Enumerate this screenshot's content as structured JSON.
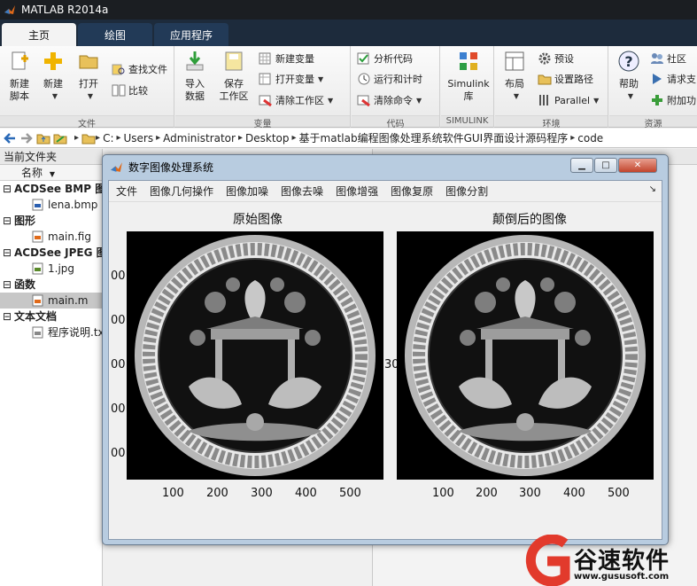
{
  "window": {
    "title": "MATLAB R2014a"
  },
  "ribbon_tabs": [
    {
      "label": "主页"
    },
    {
      "label": "绘图"
    },
    {
      "label": "应用程序"
    }
  ],
  "ribbon": {
    "new_script": "新建\n脚本",
    "new": "新建",
    "open": "打开",
    "find_files": "查找文件",
    "compare": "比较",
    "file_group": "文件",
    "import_data": "导入\n数据",
    "save_workspace": "保存\n工作区",
    "new_variable": "新建变量",
    "open_variable": "打开变量",
    "clear_workspace": "清除工作区",
    "variable_group": "变量",
    "analyze_code": "分析代码",
    "run_and_time": "运行和计时",
    "clear_commands": "清除命令",
    "code_group": "代码",
    "simulink_library": "Simulink\n库",
    "simulink_group": "SIMULINK",
    "layout": "布局",
    "preferences": "预设",
    "set_path": "设置路径",
    "parallel": "Parallel",
    "environment_group": "环境",
    "help": "帮助",
    "community": "社区",
    "request_support": "请求支",
    "addons": "附加功",
    "resources_group": "资源"
  },
  "address": {
    "crumbs": [
      "C:",
      "Users",
      "Administrator",
      "Desktop",
      "基于matlab编程图像处理系统软件GUI界面设计源码程序",
      "code"
    ]
  },
  "left_panel": {
    "title": "当前文件夹",
    "column_name": "名称",
    "items": [
      {
        "type": "cat",
        "label": "ACDSee BMP 图"
      },
      {
        "type": "file",
        "label": "lena.bmp",
        "icon": "bmp"
      },
      {
        "type": "cat",
        "label": "图形"
      },
      {
        "type": "file",
        "label": "main.fig",
        "icon": "fig"
      },
      {
        "type": "cat",
        "label": "ACDSee JPEG 图"
      },
      {
        "type": "file",
        "label": "1.jpg",
        "icon": "jpg"
      },
      {
        "type": "cat",
        "label": "函数"
      },
      {
        "type": "file",
        "label": "main.m",
        "icon": "m",
        "selected": true
      },
      {
        "type": "cat",
        "label": "文本文档"
      },
      {
        "type": "file",
        "label": "程序说明.txt",
        "icon": "txt"
      }
    ]
  },
  "figure": {
    "title": "数字图像处理系统",
    "menus": [
      "文件",
      "图像几何操作",
      "图像加噪",
      "图像去噪",
      "图像增强",
      "图像复原",
      "图像分割"
    ],
    "left_title": "原始图像",
    "right_title": "颠倒后的图像",
    "x_ticks": [
      "100",
      "200",
      "300",
      "400",
      "500"
    ],
    "y_ticks": [
      "00",
      "00",
      "00",
      "00",
      "00"
    ],
    "y_tick_partial": "30"
  },
  "watermark": {
    "brand": "谷速软件",
    "url": "www.gususoft.com"
  },
  "colors": {
    "matlab_orange": "#e06a1a",
    "ribbon_dark": "#1d2b3c",
    "watermark_red": "#e23a2c"
  }
}
